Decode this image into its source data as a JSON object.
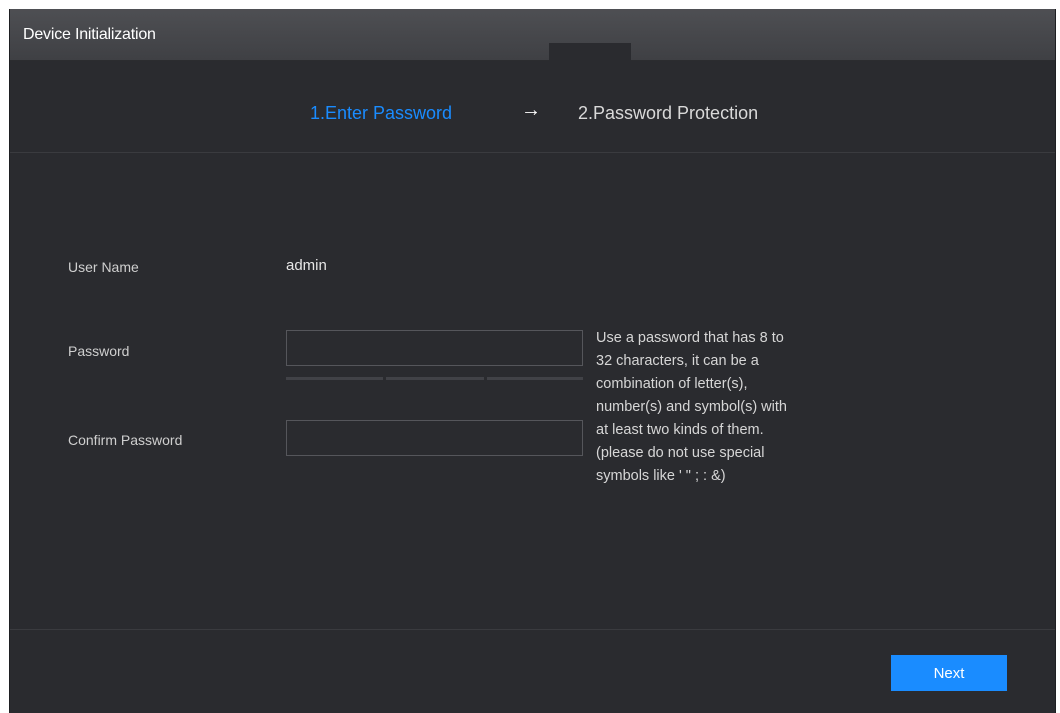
{
  "window": {
    "title": "Device Initialization"
  },
  "steps": {
    "items": [
      {
        "label": "1.Enter Password",
        "active": true
      },
      {
        "label": "2.Password Protection",
        "active": false
      }
    ],
    "arrow": "→"
  },
  "form": {
    "username_label": "User Name",
    "username_value": "admin",
    "password_label": "Password",
    "password_value": "",
    "confirm_label": "Confirm Password",
    "confirm_value": "",
    "help_lines": [
      "Use a password that has 8 to",
      "32 characters, it can be a",
      "combination of letter(s),",
      "number(s) and symbol(s) with",
      "at least two kinds of them.",
      "(please do not use special",
      "symbols like ' \" ; : &)"
    ]
  },
  "footer": {
    "next_label": "Next"
  },
  "colors": {
    "accent": "#1a8cff",
    "background": "#2a2b2f",
    "titlebar": "#45464a"
  }
}
